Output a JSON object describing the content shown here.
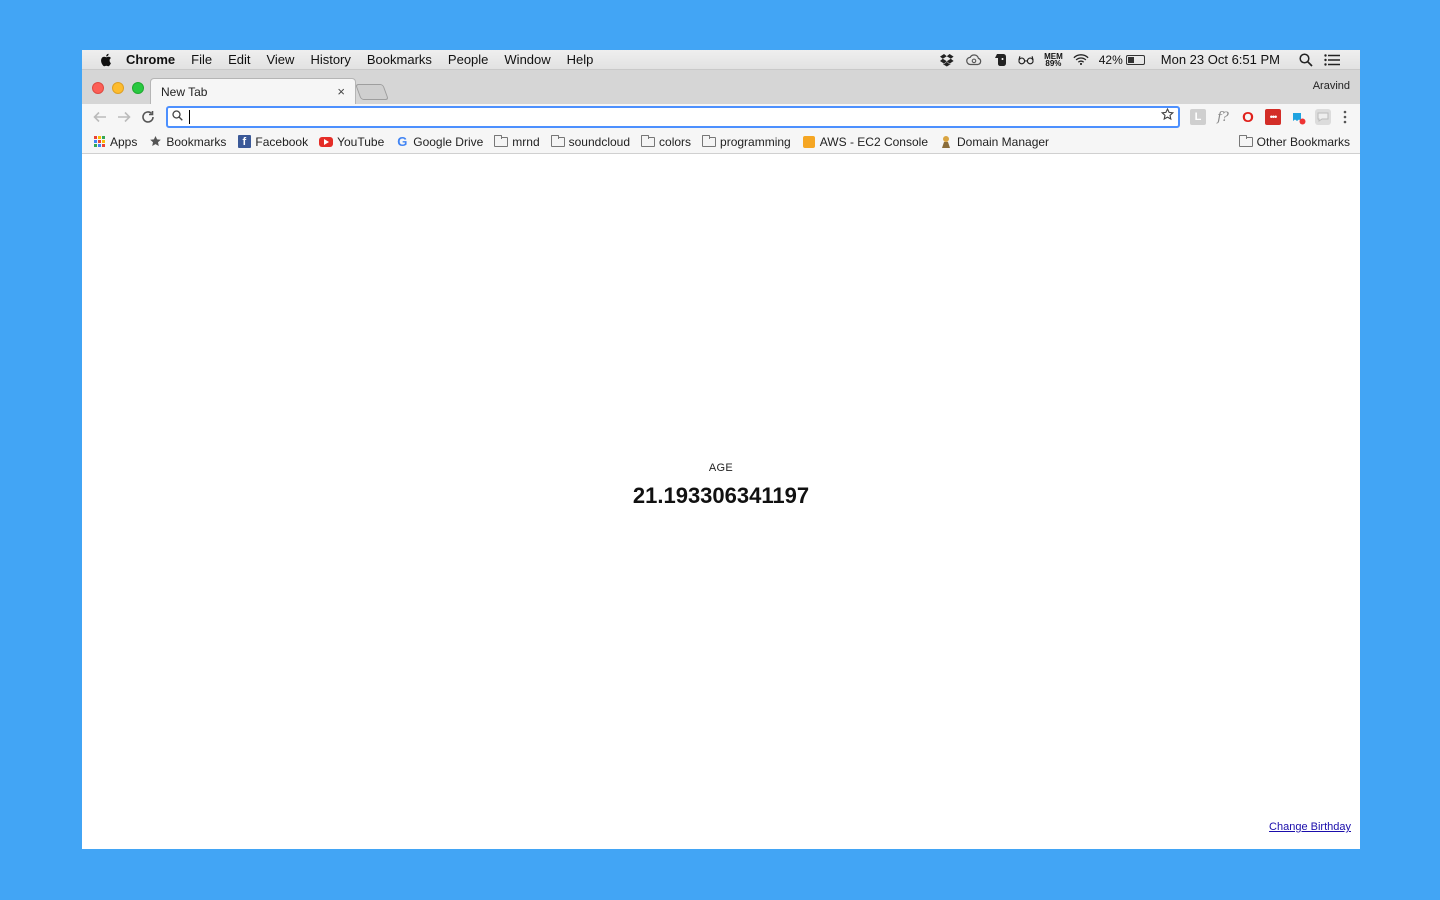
{
  "menubar": {
    "app_name": "Chrome",
    "items": [
      "File",
      "Edit",
      "View",
      "History",
      "Bookmarks",
      "People",
      "Window",
      "Help"
    ],
    "mem_label": "MEM",
    "mem_value": "89%",
    "battery_percent": "42%",
    "battery_level": 0.42,
    "clock": "Mon 23 Oct  6:51 PM"
  },
  "tabstrip": {
    "tab_title": "New Tab",
    "close_glyph": "×",
    "profile_name": "Aravind"
  },
  "toolbar": {
    "omnibox_value": "",
    "extensions": [
      "L",
      "f?",
      "O",
      "•••"
    ]
  },
  "bookmarks": {
    "items": [
      {
        "label": "Apps",
        "icon": "apps-grid-icon"
      },
      {
        "label": "Bookmarks",
        "icon": "star-icon"
      },
      {
        "label": "Facebook",
        "icon": "facebook-icon"
      },
      {
        "label": "YouTube",
        "icon": "youtube-icon"
      },
      {
        "label": "Google Drive",
        "icon": "google-icon"
      },
      {
        "label": "mrnd",
        "icon": "folder-icon"
      },
      {
        "label": "soundcloud",
        "icon": "folder-icon"
      },
      {
        "label": "colors",
        "icon": "folder-icon"
      },
      {
        "label": "programming",
        "icon": "folder-icon"
      },
      {
        "label": "AWS - EC2 Console",
        "icon": "aws-icon"
      },
      {
        "label": "Domain Manager",
        "icon": "domain-icon"
      }
    ],
    "other_label": "Other Bookmarks"
  },
  "content": {
    "age_label": "AGE",
    "age_value": "21.193306341197",
    "change_birthday": "Change Birthday"
  },
  "colors": {
    "desktop": "#42a5f5",
    "omnibox_focus": "#4d90fe",
    "link": "#1a0dab"
  }
}
